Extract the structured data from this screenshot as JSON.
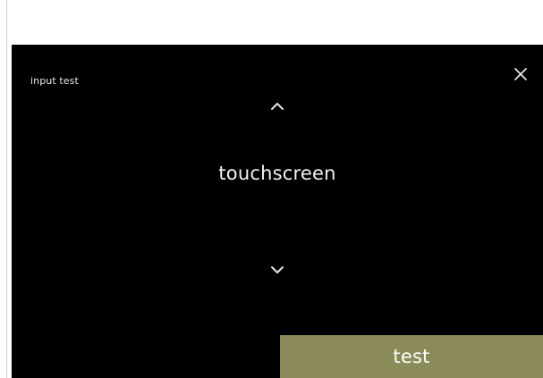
{
  "screen": {
    "title": "input test",
    "selection_label": "touchscreen",
    "icons": {
      "close": "close-icon",
      "up": "chevron-up-icon",
      "down": "chevron-down-icon"
    }
  },
  "actions": {
    "test_label": "test"
  },
  "colors": {
    "screen_bg": "#000000",
    "button_bg": "#8a8a5a",
    "text": "#f2f2f2"
  }
}
